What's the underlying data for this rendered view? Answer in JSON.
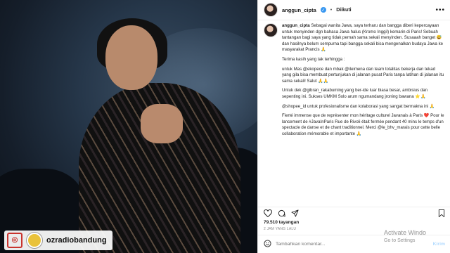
{
  "photo": {
    "watermark": {
      "handle": "ozradiobandung",
      "logo_icon": "oz-logo-icon",
      "badge_icon": "instagram-icon"
    }
  },
  "post": {
    "username": "anggun_cipta",
    "follow_label": "Diikuti",
    "caption": {
      "username": "anggun_cipta",
      "paragraphs": [
        "Sebagai wanita Jawa, saya terharu dan bangga diberi kepercayaan untuk menyinden dgn bahasa Jawa halus (Kromo Inggil) kemarin di Paris! Sebuah tantangan bagi saya yang tidak pernah sama sekali menyinden. Susaaah banget 😅 dan hasilnya belum sempurna tapi bangga sekali bisa mengenalkan budaya Jawa ke masyarakat Prancis 🙏",
        "Terima kasih yang tak terhingga :",
        "untuk Mas @ekopece dan mbak @ileimena dan team totalitas bekerja dan tekad yang gila bisa membuat pertunjukan di jalanan pusat Paris tanpa latihan di jalanan itu sama sekali! Salut 🙏🙏",
        "Untuk dek @gibran_rakabuming yang ber-ide luar biasa besar, ambisius dan sepenting ini. Sukses UMKM Solo arum ngumandang jroning bawana ⭐🙏",
        "@shopee_id untuk profesionalisme dan kolaborasi yang sangat bermakna ini 🙏",
        "Fierté immense que de représenter mon héritage culturel Javanais à Paris ❤️ Pour le lancement de #JavaInParis Rue de Rivoli était fermée pendant 40 mins le temps d'un spectacle de danse et de chant traditionnel. Merci @le_bhv_marais pour cette belle collaboration mémorable et importante 🙏"
      ]
    },
    "views": "79.510 tayangan",
    "time_ago": "2 JAM YANG LALU",
    "comment_placeholder": "Tambahkan komentar...",
    "post_button": "Kirim"
  },
  "os_overlay": {
    "activate_title": "Activate Windo",
    "activate_sub": "Go to Settings"
  },
  "icons": [
    "heart-icon",
    "comment-icon",
    "share-icon",
    "bookmark-icon",
    "emoji-icon",
    "more-icon",
    "verified-icon"
  ]
}
